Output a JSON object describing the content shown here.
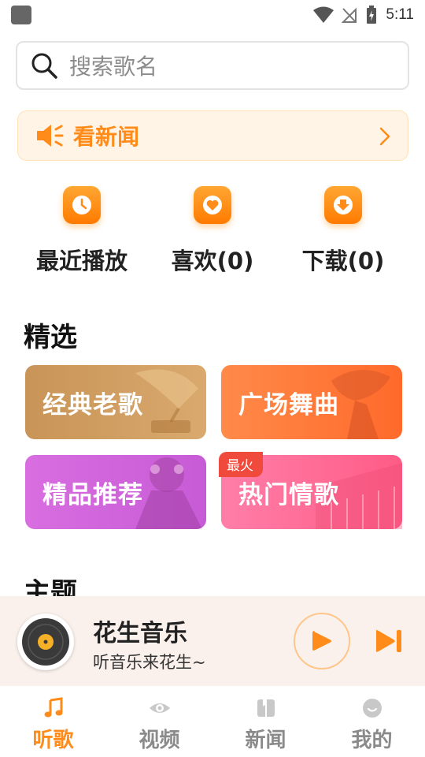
{
  "status_bar": {
    "time": "5:11"
  },
  "search": {
    "placeholder": "搜索歌名"
  },
  "news_banner": {
    "label": "看新闻"
  },
  "quick_actions": [
    {
      "label": "最近播放",
      "icon": "clock-icon"
    },
    {
      "label": "喜欢(0)",
      "icon": "heart-icon"
    },
    {
      "label": "下载(0)",
      "icon": "download-icon"
    }
  ],
  "sections": {
    "featured_title": "精选",
    "theme_title": "主题"
  },
  "featured_cards": [
    {
      "label": "经典老歌"
    },
    {
      "label": "广场舞曲"
    },
    {
      "label": "精品推荐"
    },
    {
      "label": "热门情歌",
      "badge": "最火"
    }
  ],
  "player": {
    "title": "花生音乐",
    "subtitle": "听音乐来花生~"
  },
  "bottom_nav": [
    {
      "label": "听歌",
      "icon": "music-note-icon",
      "active": true
    },
    {
      "label": "视频",
      "icon": "eye-icon"
    },
    {
      "label": "新闻",
      "icon": "book-icon"
    },
    {
      "label": "我的",
      "icon": "profile-icon"
    }
  ],
  "colors": {
    "accent": "#ff8c1a",
    "nav_inactive": "#8a8a8a",
    "badge": "#f04a3c"
  }
}
